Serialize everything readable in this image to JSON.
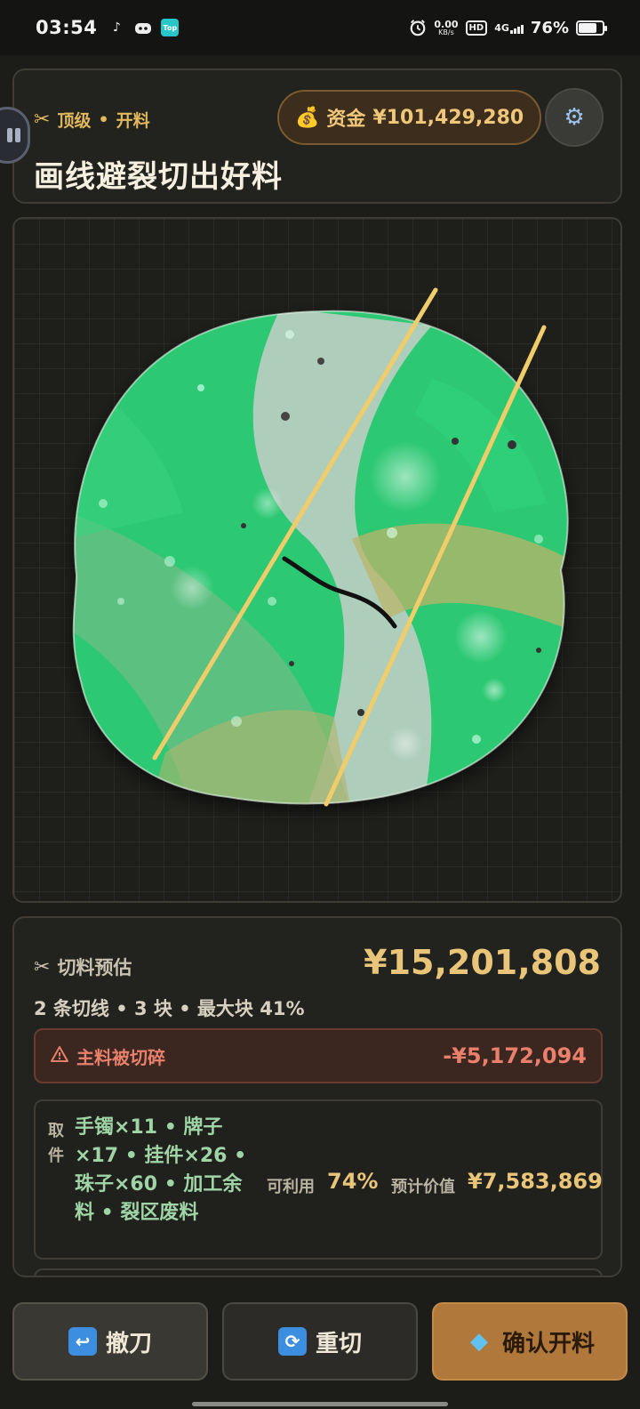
{
  "status_bar": {
    "time": "03:54",
    "net_speed": "0.00",
    "net_unit": "KB/s",
    "hd": "HD",
    "network": "4G",
    "battery": "76%",
    "battery_level": 0.76,
    "top_app_label": "Top"
  },
  "header": {
    "level": "顶级",
    "separator": "•",
    "mode": "开料",
    "title": "画线避裂切出好料",
    "funds_label": "资金",
    "funds_value": "¥101,429,280",
    "icons": {
      "level": "scissors-icon",
      "funds": "money-bag-icon",
      "settings": "gear-icon"
    }
  },
  "canvas": {
    "stone_colors": [
      "#2fcf78",
      "#bfc8c0",
      "#b7b86a"
    ],
    "cut_line_color": "#f0cd6a",
    "crack_color": "#111",
    "cut_lines_count": 2
  },
  "estimate": {
    "label": "切料预估",
    "value": "¥15,201,808",
    "stats": "2 条切线 • 3 块 • 最大块 41%",
    "warning_label": "主料被切碎",
    "warning_value": "-¥5,172,094",
    "plan": {
      "tag": "取件",
      "items": "手镯×11 • 牌子×17 • 挂件×26 • 珠子×60 • 加工余料 • 裂区废料",
      "utilization_label": "可利用",
      "utilization_value": "74%",
      "value_label": "预计价值",
      "value": "¥7,583,869"
    }
  },
  "actions": {
    "undo": "撤刀",
    "recut": "重切",
    "confirm": "确认开料"
  }
}
